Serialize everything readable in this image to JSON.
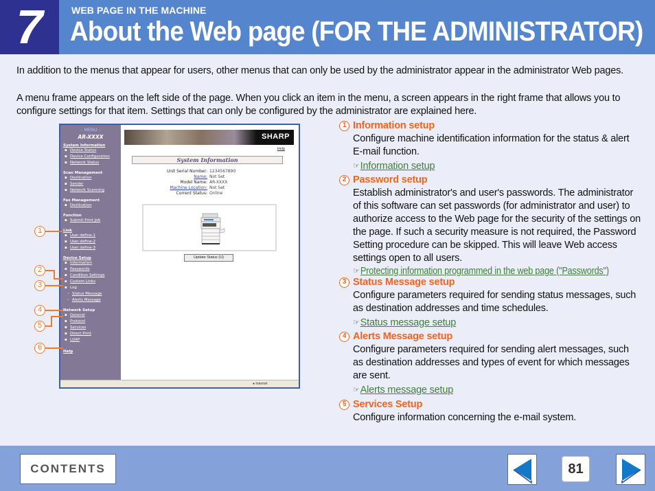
{
  "header": {
    "chapter_number": "7",
    "section_label": "WEB PAGE IN THE MACHINE",
    "title": "About the Web page (FOR THE ADMINISTRATOR)"
  },
  "intro": {
    "paragraph1": "In addition to the menus that appear for users, other menus that can only be used by the administrator appear in the administrator Web pages.",
    "paragraph2": "A menu frame appears on the left side of the page. When you click an item in the menu, a screen appears in the right frame that allows you to configure settings for that item. Settings that can only be configured by the administrator are explained here."
  },
  "screenshot": {
    "menu": {
      "title": "- MENU -",
      "model": "AR-XXXX",
      "groups": [
        {
          "label": "System Information",
          "items": [
            "Device Status",
            "Device Configuration",
            "Network Status"
          ]
        },
        {
          "label": "Scan Management",
          "items": [
            "Destination",
            "Sender",
            "Network Scanning"
          ]
        },
        {
          "label": "Fax Management",
          "items": [
            "Destination"
          ]
        },
        {
          "label": "Function",
          "items": [
            "Submit Print Job"
          ]
        },
        {
          "label": "Link",
          "items": [
            "User define-1",
            "User define-2",
            "User define-3"
          ]
        },
        {
          "label": "Device Setup",
          "items": [
            "Information",
            "Passwords",
            "Condition Settings",
            "Custom Links",
            "Log"
          ],
          "sub_items": [
            "Status Message",
            "Alerts Message"
          ]
        },
        {
          "label": "Network Setup",
          "items": [
            "General",
            "Protocol",
            "Services",
            "Direct Print",
            "LDAP"
          ]
        }
      ],
      "help": "Help"
    },
    "content": {
      "brand": "SHARP",
      "help": "Help",
      "section_title": "System Information",
      "rows": [
        {
          "key": "Unit Serial Number:",
          "value": "1234567890",
          "link": false
        },
        {
          "key": "Name:",
          "value": "Not Set",
          "link": true
        },
        {
          "key": "Model Name:",
          "value": "AR-XXXX",
          "link": false
        },
        {
          "key": "Machine Location:",
          "value": "Not Set",
          "link": true
        },
        {
          "key": "Current Status:",
          "value": "Online",
          "link": false
        }
      ],
      "update_button": "Update Status (U)"
    },
    "statusbar": {
      "zone": "Internet"
    },
    "callouts": [
      "1",
      "2",
      "3",
      "4",
      "5",
      "6"
    ]
  },
  "sections": [
    {
      "num": "1",
      "title": "Information setup",
      "desc": "Configure machine identification information for the status & alert E-mail function.",
      "ref": "Information setup"
    },
    {
      "num": "2",
      "title": "Password setup",
      "desc": "Establish administrator's and user's passwords. The administrator of this software can set passwords (for administrator and user) to authorize access to the Web page for the security of the settings on the page. If such a security measure is not required, the Password Setting procedure can be skipped. This will leave Web access settings open to all users.",
      "ref": "Protecting information programmed in the web page (\"Passwords\")"
    },
    {
      "num": "3",
      "title": "Status Message setup",
      "desc": "Configure parameters required for sending status messages, such as destination addresses and time schedules.",
      "ref": "Status message setup"
    },
    {
      "num": "4",
      "title": "Alerts Message setup",
      "desc": "Configure parameters required for sending alert messages, such as destination addresses and types of event for which messages are sent.",
      "ref": "Alerts message setup"
    },
    {
      "num": "5",
      "title": "Services Setup",
      "desc": "Configure information concerning the e-mail system."
    }
  ],
  "ref_icon": "☞",
  "footer": {
    "contents_label": "CONTENTS",
    "page_number": "81",
    "prev_icon": "prev-page-arrow",
    "next_icon": "next-page-arrow"
  }
}
